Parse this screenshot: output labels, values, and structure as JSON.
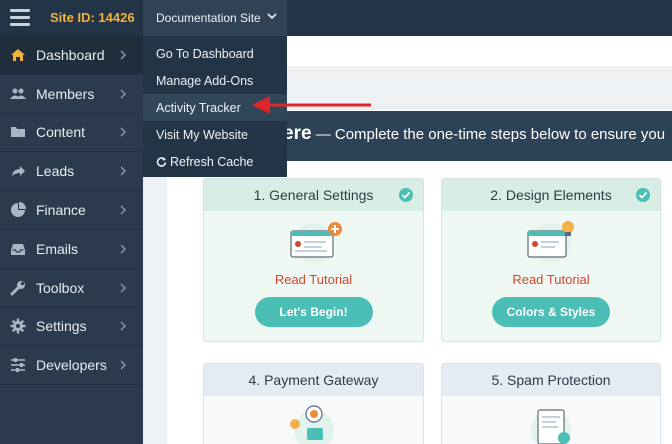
{
  "topbar": {
    "site_id": "Site ID: 14426",
    "site_select": "Documentation Site"
  },
  "sidebar": {
    "items": [
      {
        "label": "Dashboard",
        "icon": "home-icon"
      },
      {
        "label": "Members",
        "icon": "users-icon"
      },
      {
        "label": "Content",
        "icon": "folder-icon"
      },
      {
        "label": "Leads",
        "icon": "share-icon"
      },
      {
        "label": "Finance",
        "icon": "pie-chart-icon"
      },
      {
        "label": "Emails",
        "icon": "inbox-icon"
      },
      {
        "label": "Toolbox",
        "icon": "wrench-icon"
      },
      {
        "label": "Settings",
        "icon": "gear-icon"
      },
      {
        "label": "Developers",
        "icon": "sliders-icon"
      }
    ]
  },
  "dropdown": {
    "items": [
      "Go To Dashboard",
      "Manage Add-Ons",
      "Activity Tracker",
      "Visit My Website",
      "Refresh Cache"
    ]
  },
  "banner": {
    "heading_fragment": "ere",
    "text": " — Complete the one-time steps below to ensure you"
  },
  "cards": [
    {
      "title": "1. General Settings",
      "tutorial": "Read Tutorial",
      "button": "Let's Begin!"
    },
    {
      "title": "2. Design Elements",
      "tutorial": "Read Tutorial",
      "button": "Colors & Styles"
    },
    {
      "title": "4. Payment Gateway"
    },
    {
      "title": "5. Spam Protection"
    }
  ],
  "colors": {
    "accent": "#4bbeb5",
    "tutorial_red": "#d2452e",
    "site_id": "#f2b13b",
    "sidebar": "#2b3b4d",
    "annotation_arrow": "#e0262a"
  }
}
